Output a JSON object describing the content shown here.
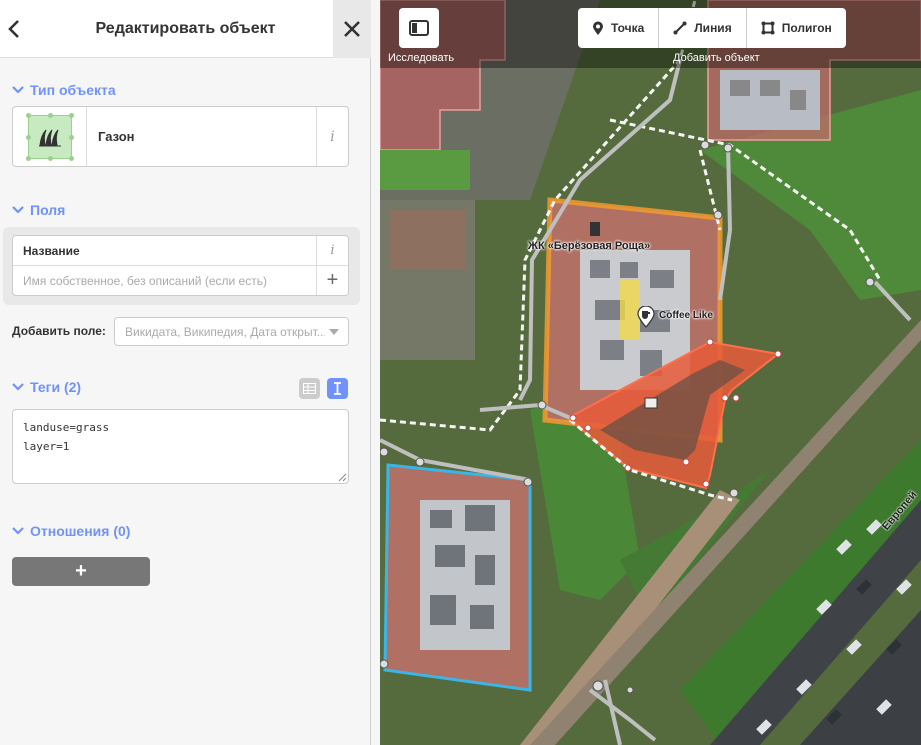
{
  "sidebar": {
    "header": {
      "title": "Редактировать объект"
    },
    "preset_section": {
      "title": "Тип объекта"
    },
    "preset": {
      "name": "Газон",
      "icon": "grass-icon"
    },
    "fields_section": {
      "title": "Поля"
    },
    "name_field": {
      "label": "Название",
      "placeholder": "Имя собственное, без описаний (если есть)",
      "value": ""
    },
    "add_field": {
      "label": "Добавить поле:",
      "placeholder": "Викидата, Википедия, Дата открыт..."
    },
    "tags_section": {
      "title": "Теги (2)"
    },
    "tags_text": "landuse=grass\nlayer=1",
    "relations_section": {
      "title": "Отношения (0)"
    },
    "add_relation": {
      "label": "+"
    }
  },
  "toolbar": {
    "explore_label": "Исследовать",
    "add_object_label": "Добавить объект",
    "modes": [
      {
        "label": "Точка",
        "icon": "point-icon"
      },
      {
        "label": "Линия",
        "icon": "line-icon"
      },
      {
        "label": "Полигон",
        "icon": "area-icon"
      }
    ]
  },
  "map": {
    "labels": {
      "complex": "ЖК «Берёзовая Роща»",
      "cafe": "Coffee Like",
      "street": "Европей"
    }
  },
  "colors": {
    "accent": "#7092ff",
    "selected": "#ff5a32",
    "highlight": "#f0a030"
  }
}
